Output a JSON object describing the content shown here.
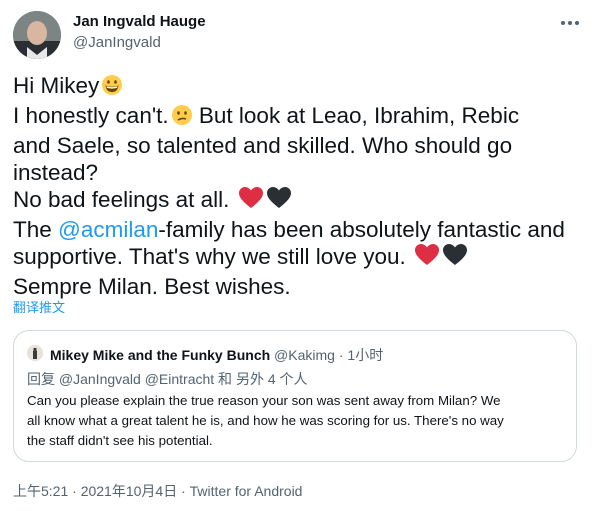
{
  "author": {
    "name": "Jan Ingvald Hauge",
    "handle": "@JanIngvald"
  },
  "tweet": {
    "line1": "Hi Mikey",
    "line2": "I honestly can't.",
    "line2b": " But look at Leao, Ibrahim, Rebic",
    "line3": "and Saele, so talented and skilled. Who should go",
    "line4": "instead?",
    "line5": "No bad feelings at all.",
    "line6_prefix": "The ",
    "line6_mention": "@acmilan",
    "line6_suffix": "-family has been absolutely fantastic and",
    "line7": "supportive. That's why we still love you.",
    "line8": "Sempre Milan. Best wishes."
  },
  "translate_label": "翻译推文",
  "quote": {
    "name": "Mikey Mike and the Funky Bunch",
    "handle": "@Kakimg",
    "separator": " · ",
    "time": "1小时",
    "reply": "回复 @JanIngvald @Eintracht 和 另外 4 个人",
    "body_line1": "Can you please explain the true reason your son was sent away from Milan? We",
    "body_line2": "all know what a great talent he is, and how he was scoring for us. There's no way",
    "body_line3": "the staff didn't see his potential."
  },
  "timestamp": "上午5:21 · 2021年10月4日 · Twitter for Android",
  "colors": {
    "link": "#1d9bf0",
    "secondary_text": "#536471",
    "border": "#cfd9de",
    "heart_red": "#dd2e44",
    "heart_black": "#292f33"
  },
  "icons": [
    "more-horizontal-icon",
    "grinning-emoji",
    "confused-emoji",
    "red-heart-emoji",
    "black-heart-emoji"
  ]
}
